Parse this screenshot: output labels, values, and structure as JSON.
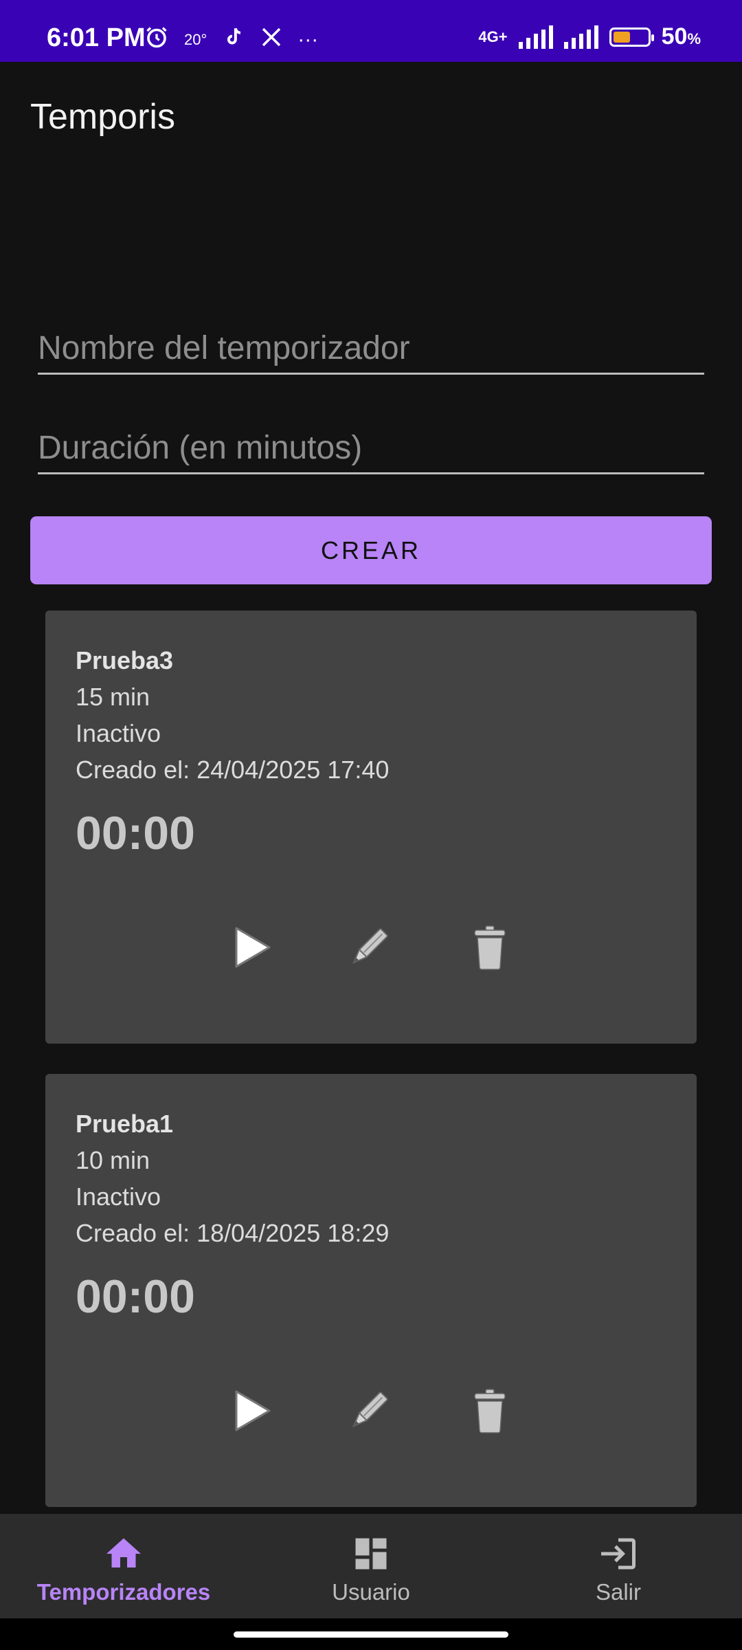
{
  "status_bar": {
    "time": "6:01 PM",
    "temperature": "20°",
    "more": "···",
    "network": "4G+",
    "battery_percent": "50",
    "battery_unit": "%",
    "battery_level": 0.5,
    "icons": [
      "alarm-icon",
      "tiktok-icon",
      "x-icon",
      "signal-icon",
      "battery-icon"
    ]
  },
  "app": {
    "title": "Temporis"
  },
  "form": {
    "name_placeholder": "Nombre del temporizador",
    "duration_placeholder": "Duración (en minutos)",
    "create_label": "CREAR"
  },
  "timers": [
    {
      "name": "Prueba3",
      "duration": "15 min",
      "status": "Inactivo",
      "created": "Creado el: 24/04/2025 17:40",
      "clock": "00:00"
    },
    {
      "name": "Prueba1",
      "duration": "10 min",
      "status": "Inactivo",
      "created": "Creado el: 18/04/2025 18:29",
      "clock": "00:00"
    }
  ],
  "nav": {
    "home": "Temporizadores",
    "user": "Usuario",
    "exit": "Salir"
  },
  "colors": {
    "status_bar": "#3a02b5",
    "accent": "#b884f7",
    "background": "#121212",
    "card": "#434343",
    "nav_bar": "#2c2c2c"
  }
}
